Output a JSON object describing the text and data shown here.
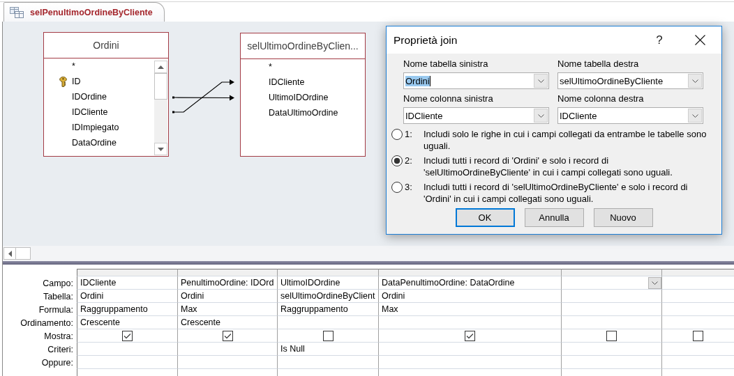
{
  "document_tab": {
    "title": "selPenultimoOrdineByCliente",
    "selected": true
  },
  "tables": [
    {
      "title": "Ordini",
      "scrollbar": true,
      "fields": [
        {
          "name": "*",
          "key": false
        },
        {
          "name": "ID",
          "key": true
        },
        {
          "name": "IDOrdine",
          "key": false
        },
        {
          "name": "IDCliente",
          "key": false
        },
        {
          "name": "IDImpiegato",
          "key": false
        },
        {
          "name": "DataOrdine",
          "key": false
        }
      ]
    },
    {
      "title": "selUltimoOrdineByClien...",
      "scrollbar": false,
      "fields": [
        {
          "name": "*",
          "key": false
        },
        {
          "name": "IDCliente",
          "key": false
        },
        {
          "name": "UltimoIDOrdine",
          "key": false
        },
        {
          "name": "DataUltimoOrdine",
          "key": false
        }
      ]
    }
  ],
  "dialog": {
    "title": "Proprietà join",
    "help": "?",
    "fields": [
      {
        "label": "Nome tabella sinistra",
        "value": "Ordini",
        "text_selected": true
      },
      {
        "label": "Nome tabella destra",
        "value": "selUltimoOrdineByCliente",
        "text_selected": false
      },
      {
        "label": "Nome colonna sinistra",
        "value": "IDCliente",
        "text_selected": false
      },
      {
        "label": "Nome colonna destra",
        "value": "IDCliente",
        "text_selected": false
      }
    ],
    "options": [
      {
        "number": "1:",
        "text": "Includi solo le righe in cui i campi collegati da entrambe le tabelle sono uguali.",
        "selected": false
      },
      {
        "number": "2:",
        "text": "Includi tutti i record di 'Ordini' e solo i record di 'selUltimoOrdineByCliente' in cui i campi collegati sono uguali.",
        "selected": true
      },
      {
        "number": "3:",
        "text": "Includi tutti i record di 'selUltimoOrdineByCliente' e solo i record di 'Ordini' in cui i campi collegati sono uguali.",
        "selected": false
      }
    ],
    "buttons": [
      {
        "label": "OK",
        "default": true
      },
      {
        "label": "Annulla",
        "default": false
      },
      {
        "label": "Nuovo",
        "default": false
      }
    ]
  },
  "grid": {
    "row_labels": [
      "Campo:",
      "Tabella:",
      "Formula:",
      "Ordinamento:",
      "Mostra:",
      "Criteri:",
      "Oppure:"
    ],
    "columns": [
      {
        "field": "IDCliente",
        "table": "Ordini",
        "total": "Raggruppamento",
        "sort": "Crescente",
        "show": true,
        "dropdown": false
      },
      {
        "field": "PenultimoOrdine: IDOrd",
        "table": "Ordini",
        "total": "Max",
        "sort": "Crescente",
        "show": true,
        "dropdown": false
      },
      {
        "field": "UltimoIDOrdine",
        "table": "selUltimoOrdineByClient",
        "total": "Raggruppamento",
        "show": false,
        "criteria": "Is Null",
        "dropdown": false
      },
      {
        "field": "DataPenultimoOrdine: DataOrdine",
        "table": "Ordini",
        "total": "Max",
        "show": true,
        "dropdown": false
      },
      {
        "show": false,
        "dropdown": true
      },
      {
        "show": false,
        "dropdown": false
      }
    ]
  }
}
